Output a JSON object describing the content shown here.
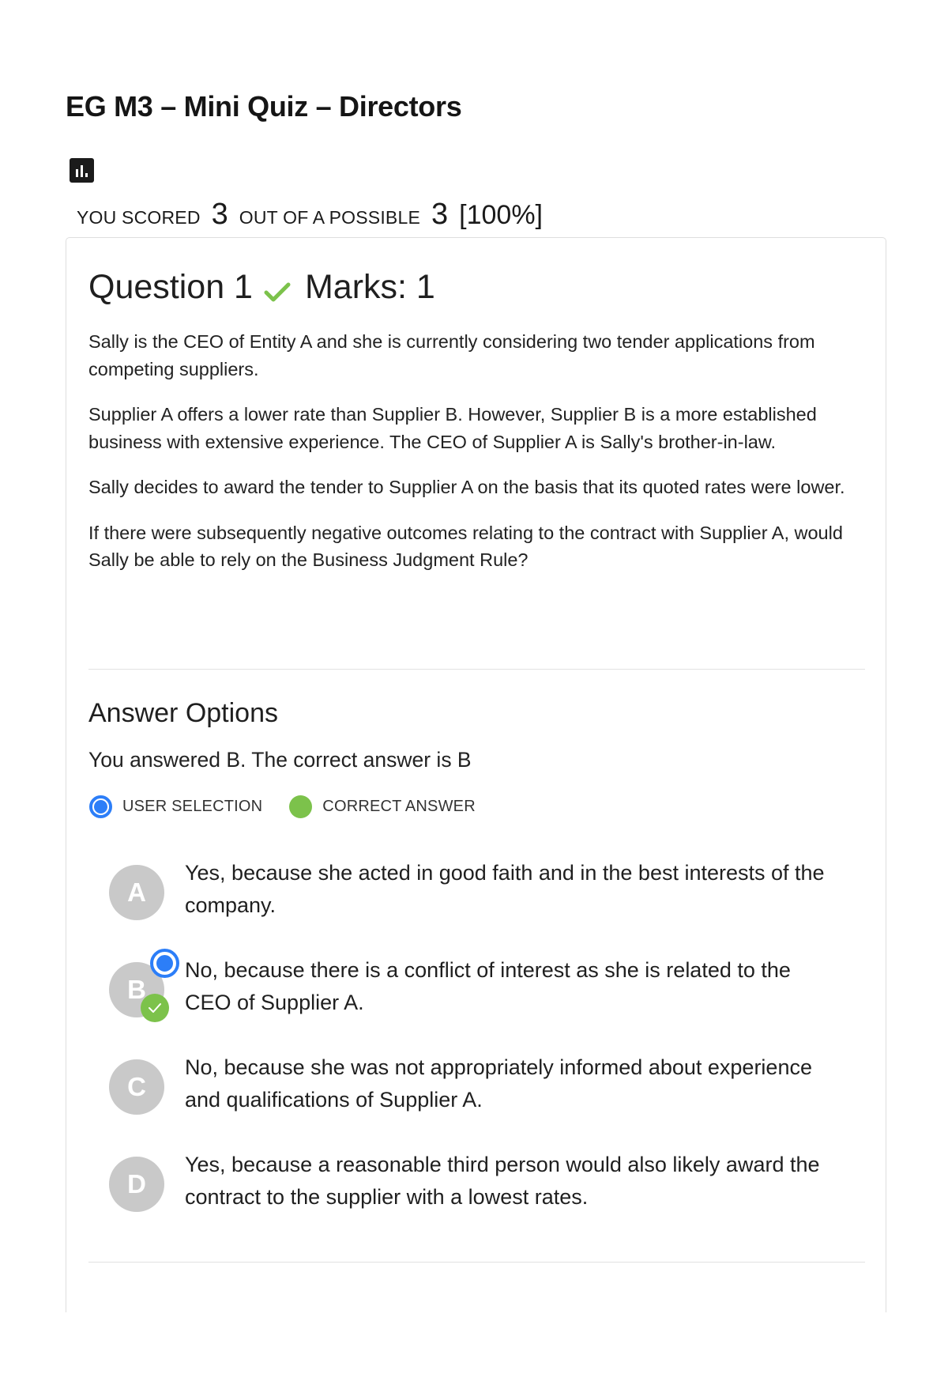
{
  "quiz": {
    "title": "EG M3 – Mini Quiz – Directors",
    "stats_icon": "bar-chart-icon"
  },
  "score": {
    "you_scored_label": "YOU SCORED",
    "scored": "3",
    "out_of_label": "OUT OF A POSSIBLE",
    "possible": "3",
    "percent": "[100%]"
  },
  "question": {
    "title": "Question 1",
    "status_icon": "check-icon",
    "marks": "Marks: 1",
    "paragraphs": [
      "Sally is the CEO of Entity A and she is currently considering two tender applications from competing suppliers.",
      "Supplier A offers a lower rate than Supplier B. However, Supplier B is a more established business with extensive experience. The CEO of Supplier A is Sally's brother-in-law.",
      "Sally decides to award the tender to Supplier A on the basis that its quoted rates were lower.",
      "If there were subsequently negative outcomes relating to the contract with Supplier A, would Sally be able to rely on the Business Judgment Rule?"
    ]
  },
  "answers": {
    "heading": "Answer Options",
    "summary": "You answered B. The correct answer is B",
    "legend": {
      "user_selection": "USER SELECTION",
      "correct_answer": "CORRECT ANSWER"
    },
    "options": [
      {
        "letter": "A",
        "text": "Yes, because she acted in good faith and in the best interests of the company."
      },
      {
        "letter": "B",
        "text": "No, because there is a conflict of interest as she is related to the CEO of Supplier A."
      },
      {
        "letter": "C",
        "text": "No, because she was not appropriately informed about experience and qualifications of Supplier A."
      },
      {
        "letter": "D",
        "text": "Yes, because a reasonable third person would also likely award the contract to the supplier with a lowest rates."
      }
    ],
    "user_selection": "B",
    "correct": "B"
  },
  "colors": {
    "selection_blue": "#2c7ef8",
    "correct_green": "#7cc24b",
    "option_circle_gray": "#c9c9c9"
  }
}
